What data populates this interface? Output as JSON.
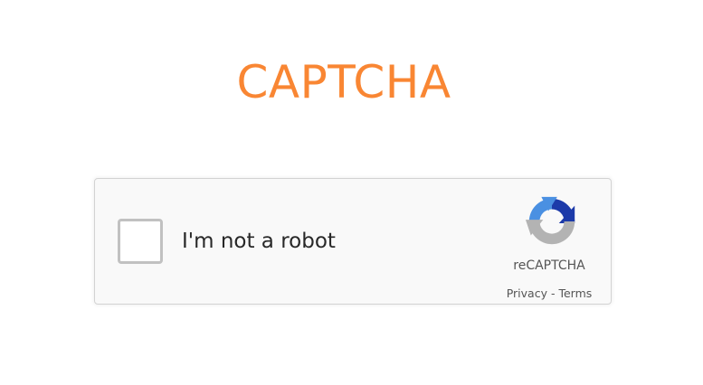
{
  "page": {
    "title": "CAPTCHA",
    "title_color": "#f98633"
  },
  "recaptcha": {
    "checkbox_label": "I'm not a robot",
    "checked": false,
    "brand": "reCAPTCHA",
    "privacy_link": "Privacy",
    "separator": "-",
    "terms_link": "Terms",
    "logo_icon": "recaptcha-logo-icon",
    "colors": {
      "blue_dark": "#1c3aa9",
      "blue_light": "#4a90e2",
      "gray": "#b3b3b3"
    }
  }
}
